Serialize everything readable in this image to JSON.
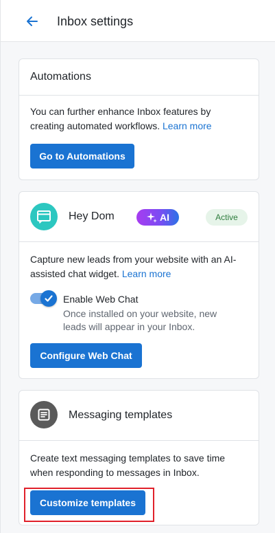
{
  "header": {
    "title": "Inbox settings",
    "back_icon": "arrow-left-icon"
  },
  "automations": {
    "title": "Automations",
    "description": "You can further enhance Inbox features by creating automated workflows.",
    "learn_more": "Learn more",
    "button": "Go to Automations"
  },
  "webchat": {
    "icon": "chat-window-icon",
    "name": "Hey Dom",
    "ai_badge": "AI",
    "ai_icon": "sparkle-icon",
    "status": "Active",
    "description": "Capture new leads from your website with an AI-assisted chat widget.",
    "learn_more": "Learn more",
    "toggle_label": "Enable Web Chat",
    "toggle_state": "on",
    "toggle_help": "Once installed on your website, new leads will appear in your Inbox.",
    "button": "Configure Web Chat"
  },
  "templates": {
    "icon": "document-lines-icon",
    "title": "Messaging templates",
    "description": "Create text messaging templates to save time when responding to messages in Inbox.",
    "button": "Customize templates"
  },
  "colors": {
    "accent": "#1a73d2",
    "active_badge_bg": "#e6f4e9",
    "active_badge_text": "#2e7d3d",
    "highlight": "#e0202a",
    "chat_avatar": "#2cc7c0"
  }
}
